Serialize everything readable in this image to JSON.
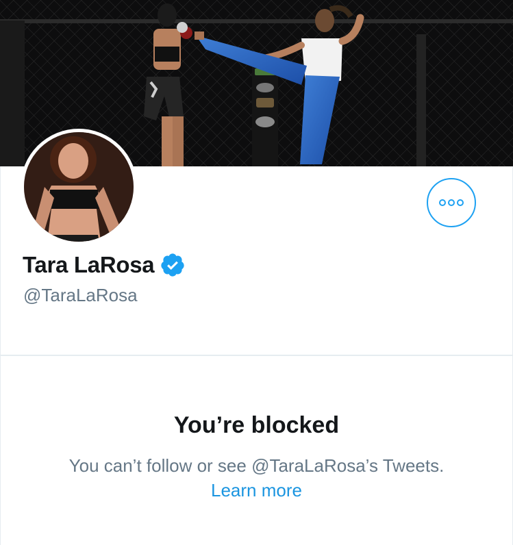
{
  "profile": {
    "name": "Tara LaRosa",
    "handle": "@TaraLaRosa",
    "verified": true,
    "icons": {
      "verified": "verified-badge-icon",
      "more": "more-options-icon"
    }
  },
  "blocked": {
    "title": "You’re blocked",
    "description": "You can’t follow or see @TaraLaRosa’s Tweets.",
    "learn_more": "Learn more"
  },
  "colors": {
    "accent": "#1da1f2",
    "link": "#1b95e0",
    "text_primary": "#14171a",
    "text_secondary": "#657786",
    "divider": "#e6ecf0"
  }
}
